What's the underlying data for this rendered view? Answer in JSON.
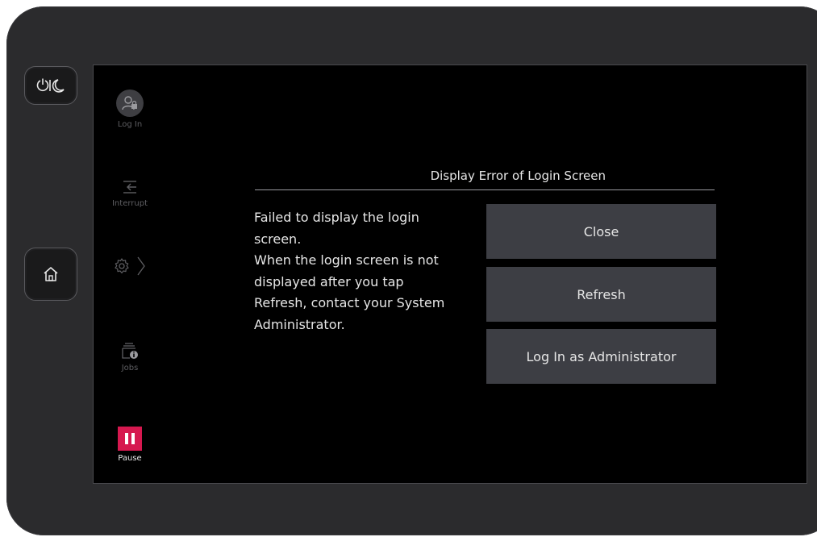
{
  "hardware": {
    "power_icon": "power-sleep-icon",
    "home_icon": "home-icon"
  },
  "sidebar": {
    "login": {
      "label": "Log In",
      "icon": "user-lock-icon"
    },
    "interrupt": {
      "label": "Interrupt",
      "icon": "interrupt-icon"
    },
    "settings": {
      "icon": "gear-icon",
      "chevron": "chevron-right-icon"
    },
    "jobs": {
      "label": "Jobs",
      "icon": "jobs-info-icon"
    },
    "pause": {
      "label": "Pause",
      "icon": "pause-icon"
    }
  },
  "dialog": {
    "title": "Display Error of Login Screen",
    "message_lines": [
      "Failed to display the login",
      "screen.",
      "When the login screen is not",
      "displayed after you tap",
      "Refresh, contact your System",
      "Administrator."
    ],
    "buttons": {
      "close": "Close",
      "refresh": "Refresh",
      "admin_login": "Log In as Administrator"
    }
  },
  "colors": {
    "screen_bg": "#000000",
    "bezel": "#2b2b2d",
    "button_bg": "#3d3e44",
    "pause_accent": "#d6184f",
    "text": "#e6e6e6",
    "muted": "#5e5e62"
  }
}
